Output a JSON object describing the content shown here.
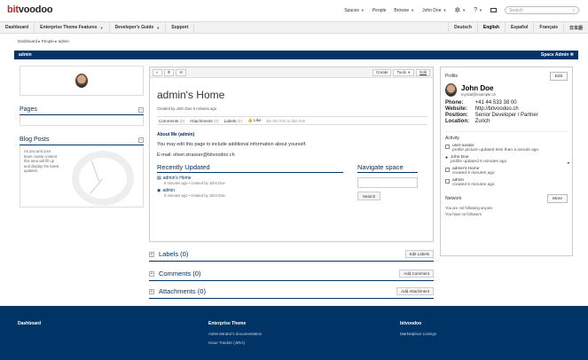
{
  "logo": {
    "prefix": "bit",
    "suffix": "voodoo"
  },
  "topnav": {
    "spaces": "Spaces",
    "people": "People",
    "browse": "Browse",
    "user": "John Doe",
    "search_placeholder": "Search"
  },
  "navbar": {
    "items": [
      "Dashboard",
      "Enterprise Theme Features",
      "Developer's Guide",
      "Support"
    ],
    "languages": [
      "Deutsch",
      "English",
      "Español",
      "Français",
      "日本語"
    ]
  },
  "breadcrumb": {
    "items": [
      "Dashboard",
      "People",
      "admin"
    ]
  },
  "spacebar": {
    "title": "admin",
    "admin_label": "Space Admin"
  },
  "left": {
    "pages_title": "Pages",
    "blog_title": "Blog Posts",
    "blog_text": "As you and your team create content this area will fill up and display the latest updates."
  },
  "toolbar": {
    "create": "Create",
    "tools": "Tools",
    "edit": "Edit"
  },
  "main": {
    "title": "admin's Home",
    "created_by": "Created by John Doe 6 minutes ago",
    "tabs": {
      "comments": "Comments",
      "comments_count": "(0)",
      "attachments": "Attachments",
      "attachments_count": "(0)",
      "labels": "Labels",
      "labels_count": "(0)",
      "like": "Like",
      "like_hint": "Be the first to like this"
    },
    "about_title": "About Me (admin)",
    "about_text": "You may edit this page to include additional information about yourself.",
    "email_text": "E-mail: oliver.strasser@bitvoodoo.ch",
    "recently_updated_title": "Recently Updated",
    "recent": [
      {
        "title": "admin's Home",
        "meta": "6 minutes ago • created by John Doe"
      },
      {
        "title": "admin",
        "meta": "6 minutes ago • created by John Doe"
      }
    ],
    "navigate_title": "Navigate space",
    "navigate_button": "Search"
  },
  "sections": {
    "labels": {
      "title": "Labels (0)",
      "button": "Edit Labels"
    },
    "comments": {
      "title": "Comments  (0)",
      "button": "Add Comment"
    },
    "attachments": {
      "title": "Attachments  (0)",
      "button": "Add Attachment"
    }
  },
  "profile": {
    "header": "Profile",
    "edit": "Edit",
    "name": "John Doe",
    "email": "mymail@example.ch",
    "phone_label": "Phone:",
    "phone": "+41 44 533 38 00",
    "website_label": "Website:",
    "website": "http://bitvoodoo.ch",
    "position_label": "Position:",
    "position": "Senior Developer / Partner",
    "location_label": "Location:",
    "location": "Zurich",
    "activity_title": "Activity",
    "activity": [
      {
        "title": "user-avatar",
        "sub": "profile picture updated less than a minute ago"
      },
      {
        "title": "John Doe",
        "sub": "profile updated 5 minutes ago"
      },
      {
        "title": "admin's Home",
        "sub": "created 6 minutes ago"
      },
      {
        "title": "admin",
        "sub": "created 6 minutes ago"
      }
    ],
    "network_title": "Network",
    "more": "More",
    "network_lines": [
      "You are not following anyone",
      "You have no followers"
    ]
  },
  "footer": {
    "col1_title": "Dashboard",
    "col2_title": "Enterprise Theme",
    "col2_links": [
      "Administrator's documentation",
      "Issue Tracker (JIRA)"
    ],
    "col3_title": "bitvoodoo",
    "col3_links": [
      "Marketplace Listings"
    ]
  },
  "colors": {
    "brand": "#003366",
    "logo_accent": "#c1272d"
  }
}
